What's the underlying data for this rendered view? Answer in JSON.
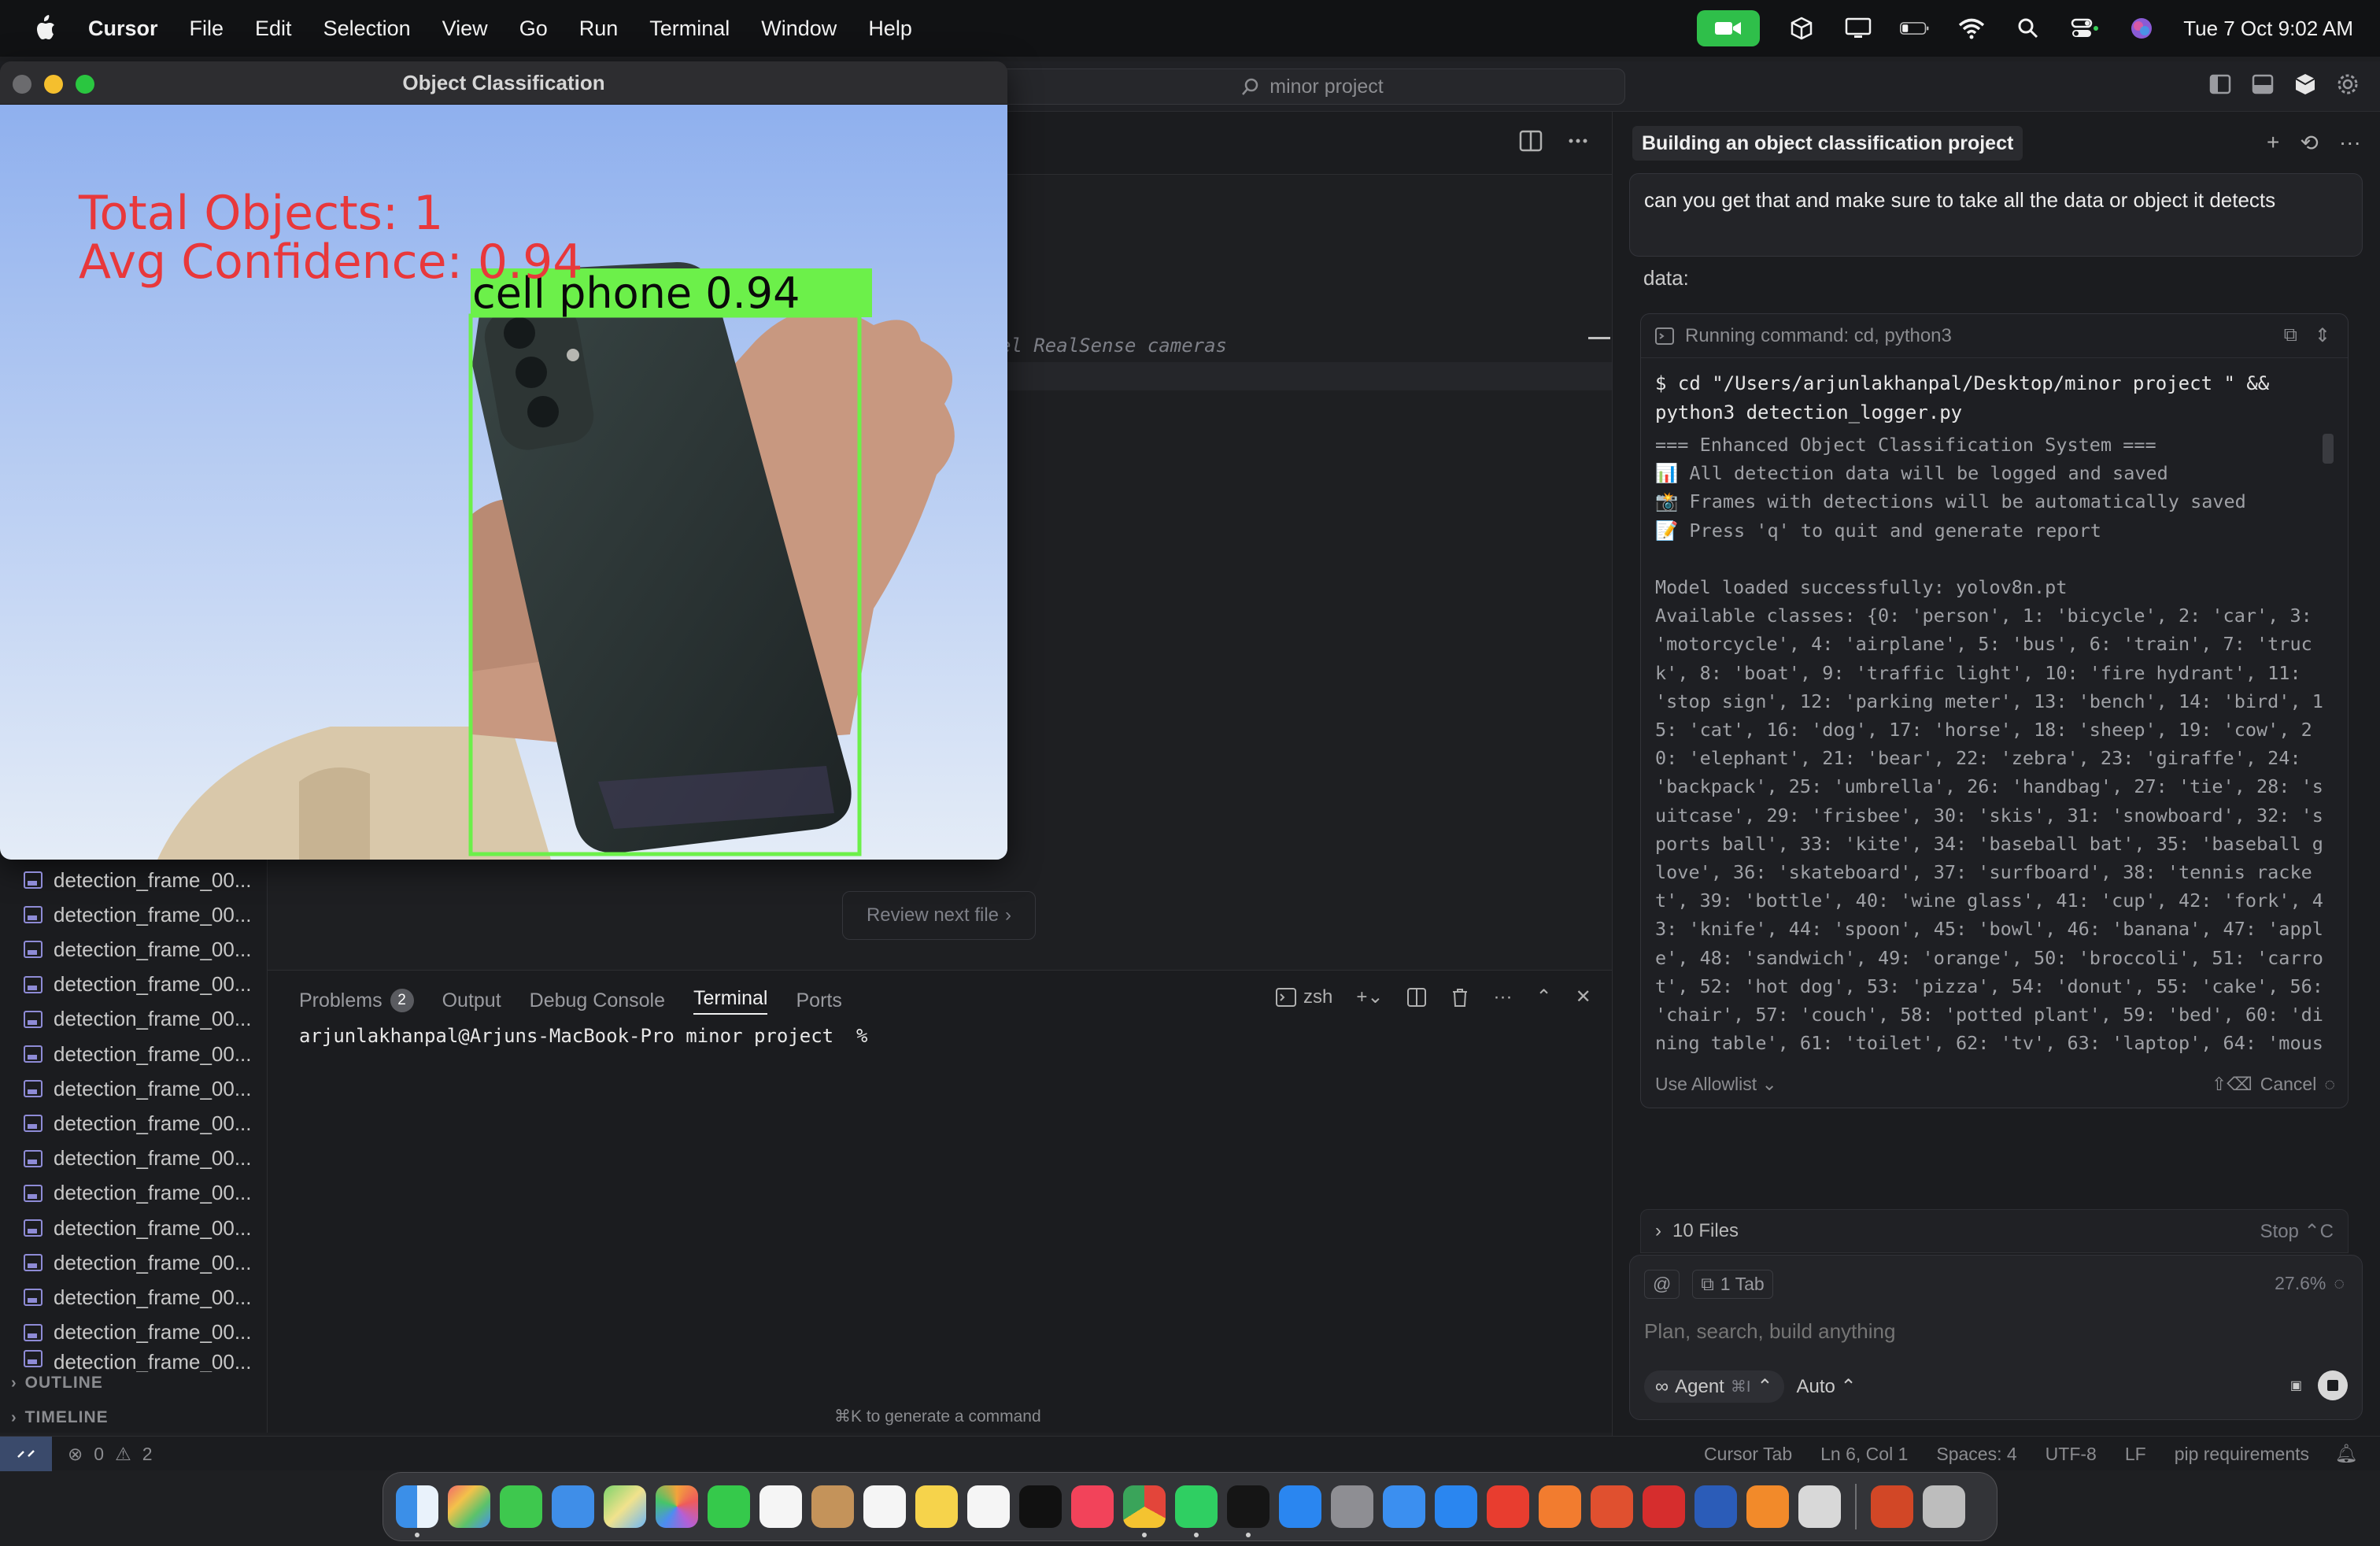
{
  "menubar": {
    "app_name": "Cursor",
    "items": [
      "File",
      "Edit",
      "Selection",
      "View",
      "Go",
      "Run",
      "Terminal",
      "Window",
      "Help"
    ],
    "clock": "Tue 7 Oct  9:02 AM"
  },
  "window": {
    "search_text": "minor project"
  },
  "sidebar": {
    "files": [
      "detection_frame_00...",
      "detection_frame_00...",
      "detection_frame_00...",
      "detection_frame_00...",
      "detection_frame_00...",
      "detection_frame_00...",
      "detection_frame_00...",
      "detection_frame_00...",
      "detection_frame_00...",
      "detection_frame_00...",
      "detection_frame_00...",
      "detection_frame_00...",
      "detection_frame_00...",
      "detection_frame_00...",
      "detection_frame_00..."
    ],
    "outline_label": "OUTLINE",
    "timeline_label": "TIMELINE"
  },
  "editor": {
    "code_fragment": "el RealSense cameras",
    "review_button": "Review next file"
  },
  "panel": {
    "tabs": [
      "Problems",
      "Output",
      "Debug Console",
      "Terminal",
      "Ports"
    ],
    "problems_count": "2",
    "shell_name": "zsh",
    "terminal_prompt": "arjunlakhanpal@Arjuns-MacBook-Pro minor project  %",
    "generate_hint": "⌘K to generate a command"
  },
  "statusbar": {
    "errors": "0",
    "warnings": "2",
    "right_items": [
      "Cursor Tab",
      "Ln 6, Col 1",
      "Spaces: 4",
      "UTF-8",
      "LF",
      "pip requirements"
    ]
  },
  "chat": {
    "tab_title": "Building an object classification project",
    "user_message": "can you get that and make sure to take all the data or object it detects",
    "data_label": "data:",
    "command_header": "Running command: cd, python3",
    "command_text": "$ cd \"/Users/arjunlakhanpal/Desktop/minor project \" &&\npython3 detection_logger.py",
    "command_output": "=== Enhanced Object Classification System ===\n📊 All detection data will be logged and saved\n📸 Frames with detections will be automatically saved\n📝 Press 'q' to quit and generate report\n\nModel loaded successfully: yolov8n.pt\nAvailable classes: {0: 'person', 1: 'bicycle', 2: 'car', 3:\n'motorcycle', 4: 'airplane', 5: 'bus', 6: 'train', 7: 'truc\nk', 8: 'boat', 9: 'traffic light', 10: 'fire hydrant', 11:\n'stop sign', 12: 'parking meter', 13: 'bench', 14: 'bird', 1\n5: 'cat', 16: 'dog', 17: 'horse', 18: 'sheep', 19: 'cow', 2\n0: 'elephant', 21: 'bear', 22: 'zebra', 23: 'giraffe', 24:\n'backpack', 25: 'umbrella', 26: 'handbag', 27: 'tie', 28: 's\nuitcase', 29: 'frisbee', 30: 'skis', 31: 'snowboard', 32: 's\nports ball', 33: 'kite', 34: 'baseball bat', 35: 'baseball g\nlove', 36: 'skateboard', 37: 'surfboard', 38: 'tennis racke\nt', 39: 'bottle', 40: 'wine glass', 41: 'cup', 42: 'fork', 4\n3: 'knife', 44: 'spoon', 45: 'bowl', 46: 'banana', 47: 'appl\ne', 48: 'sandwich', 49: 'orange', 50: 'broccoli', 51: 'carro\nt', 52: 'hot dog', 53: 'pizza', 54: 'donut', 55: 'cake', 56:\n'chair', 57: 'couch', 58: 'potted plant', 59: 'bed', 60: 'di\nning table', 61: 'toilet', 62: 'tv', 63: 'laptop', 64: 'mous",
    "allowlist_label": "Use Allowlist",
    "cancel_label": "Cancel",
    "files_label": "10 Files",
    "stop_label": "Stop",
    "tab_chip": "1 Tab",
    "context_pct": "27.6%",
    "input_placeholder": "Plan, search, build anything",
    "agent_label": "Agent",
    "agent_shortcut": "⌘I",
    "model_label": "Auto"
  },
  "classification_window": {
    "title": "Object Classification",
    "total_objects_text": "Total Objects: 1",
    "avg_confidence_text": "Avg Confidence: 0.94",
    "detection_label": "cell phone 0.94",
    "overlay_color": "#e8383b",
    "box_color": "#6cf04a"
  },
  "colors": {
    "accent": "#2fbf4a",
    "background": "#1e1f22"
  }
}
